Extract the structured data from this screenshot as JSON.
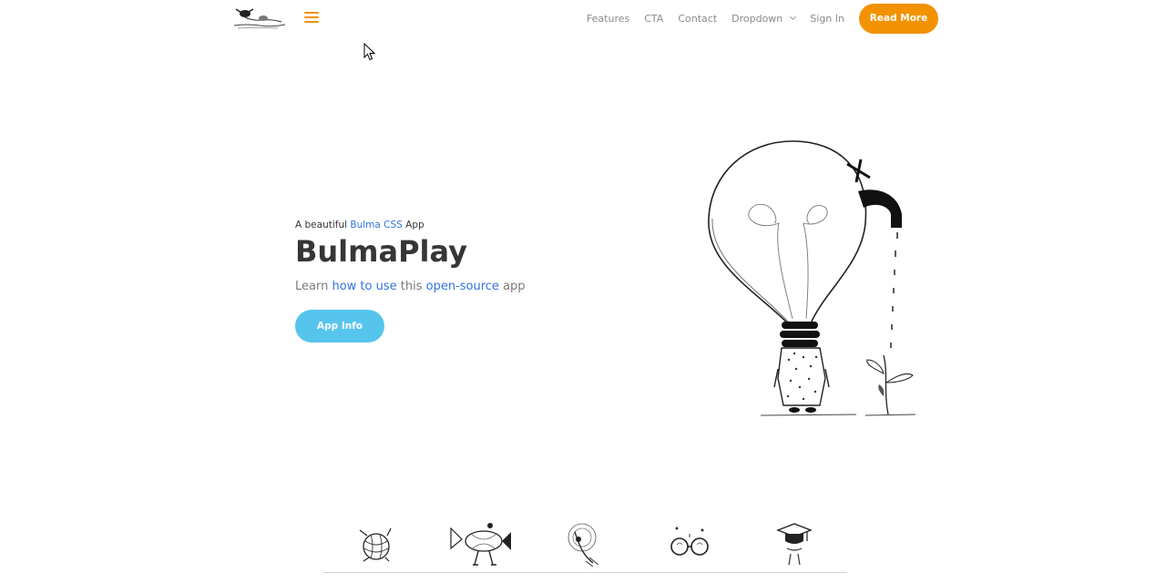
{
  "navbar": {
    "logo_icon": "doodle-logo-icon",
    "menu_icon": "hamburger-menu-icon",
    "links": [
      "Features",
      "CTA",
      "Contact"
    ],
    "dropdown_label": "Dropdown",
    "sign_in_label": "Sign In",
    "cta_label": "Read More"
  },
  "hero": {
    "subtitle_prefix": "A beautiful ",
    "subtitle_link": "Bulma CSS",
    "subtitle_suffix": " App",
    "title": "BulmaPlay",
    "desc_part1": "Learn ",
    "desc_link1": "how to use",
    "desc_part2": " this ",
    "desc_link2": "open-source",
    "desc_part3": " app",
    "button_label": "App Info",
    "illustration_icon": "lightbulb-faucet-plant-illustration"
  },
  "features_icons": [
    "ball-of-yarn-icon",
    "walking-fish-icon",
    "swirl-character-icon",
    "glasses-icon",
    "graduation-cap-icon"
  ],
  "colors": {
    "accent": "#f39200",
    "primary_button": "#56c5ee",
    "link": "#3273dc",
    "text": "#363636",
    "muted": "#7a7a7a"
  }
}
